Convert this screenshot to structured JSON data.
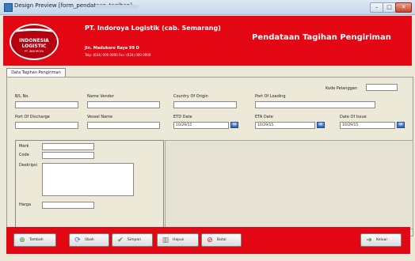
{
  "window": {
    "title": "Design Preview [form_pendataan_tagihan]"
  },
  "header": {
    "logo_lines": [
      "INDONESIA",
      "LOGISTIC",
      "PT. INDOROYA"
    ],
    "company": "PT. Indoroya Logistik (cab. Semarang)",
    "address": "Jln. Madukoro Raya 99 D",
    "phone": "Telp: (024) 000 0000  Fax: (024) 000 0000",
    "app_title": "Pendataan Tagihan Pengiriman"
  },
  "tab": {
    "label": "Data Tagihan Pengiriman"
  },
  "form": {
    "kode_pelanggan_label": "Kode Pelanggan",
    "bl_no_label": "B/L No.",
    "name_vendor_label": "Name Vendor",
    "country_of_origin_label": "Country Of Origin",
    "port_of_loading_label": "Port Of Loading",
    "port_of_discharge_label": "Port Of Discharge",
    "vessel_name_label": "Vessel Name",
    "etd_date_label": "ETD Date",
    "eta_date_label": "ETA Date",
    "date_of_issue_label": "Date Of Issue",
    "etd_date_value": "10/29/15",
    "eta_date_value": "10/29/15",
    "date_of_issue_value": "10/29/15"
  },
  "detail": {
    "merk_label": "Merk",
    "code_label": "Code",
    "deskripsi_label": "Deskripsi",
    "harga_label": "Harga"
  },
  "toolbar": {
    "tambah": "Tambah",
    "ubah": "Ubah",
    "simpan": "Simpan",
    "hapus": "Hapus",
    "batal": "Batal",
    "keluar": "Keluar"
  },
  "colors": {
    "brand_red": "#e30613"
  }
}
